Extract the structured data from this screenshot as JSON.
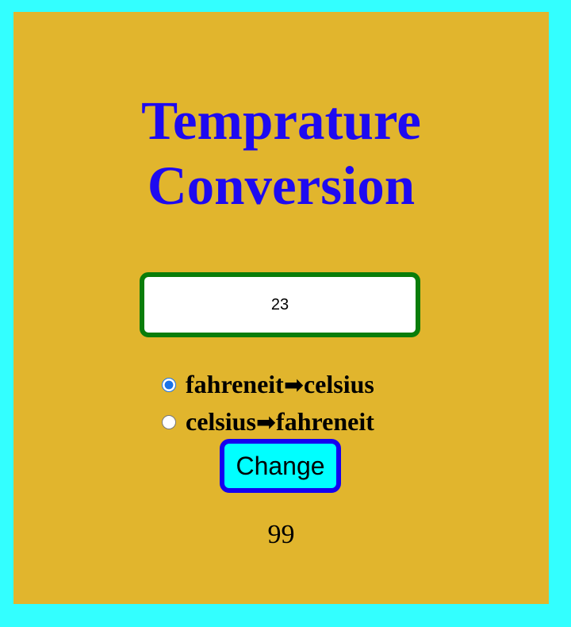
{
  "page": {
    "title_line1": "Temprature",
    "title_line2": "Conversion"
  },
  "input": {
    "value": "23"
  },
  "options": [
    {
      "from": "fahreneit",
      "arrow": "➡",
      "to": "celsius",
      "checked": true
    },
    {
      "from": "celsius",
      "arrow": "➡",
      "to": "fahreneit",
      "checked": false
    }
  ],
  "button": {
    "label": "Change"
  },
  "result": {
    "value": "99"
  },
  "colors": {
    "page_background": "#33ffff",
    "card_background": "#e1b52d",
    "title": "#1e0af0",
    "input_border": "#0a7d0a",
    "button_background": "#00ffff",
    "button_border": "#1400f0"
  }
}
